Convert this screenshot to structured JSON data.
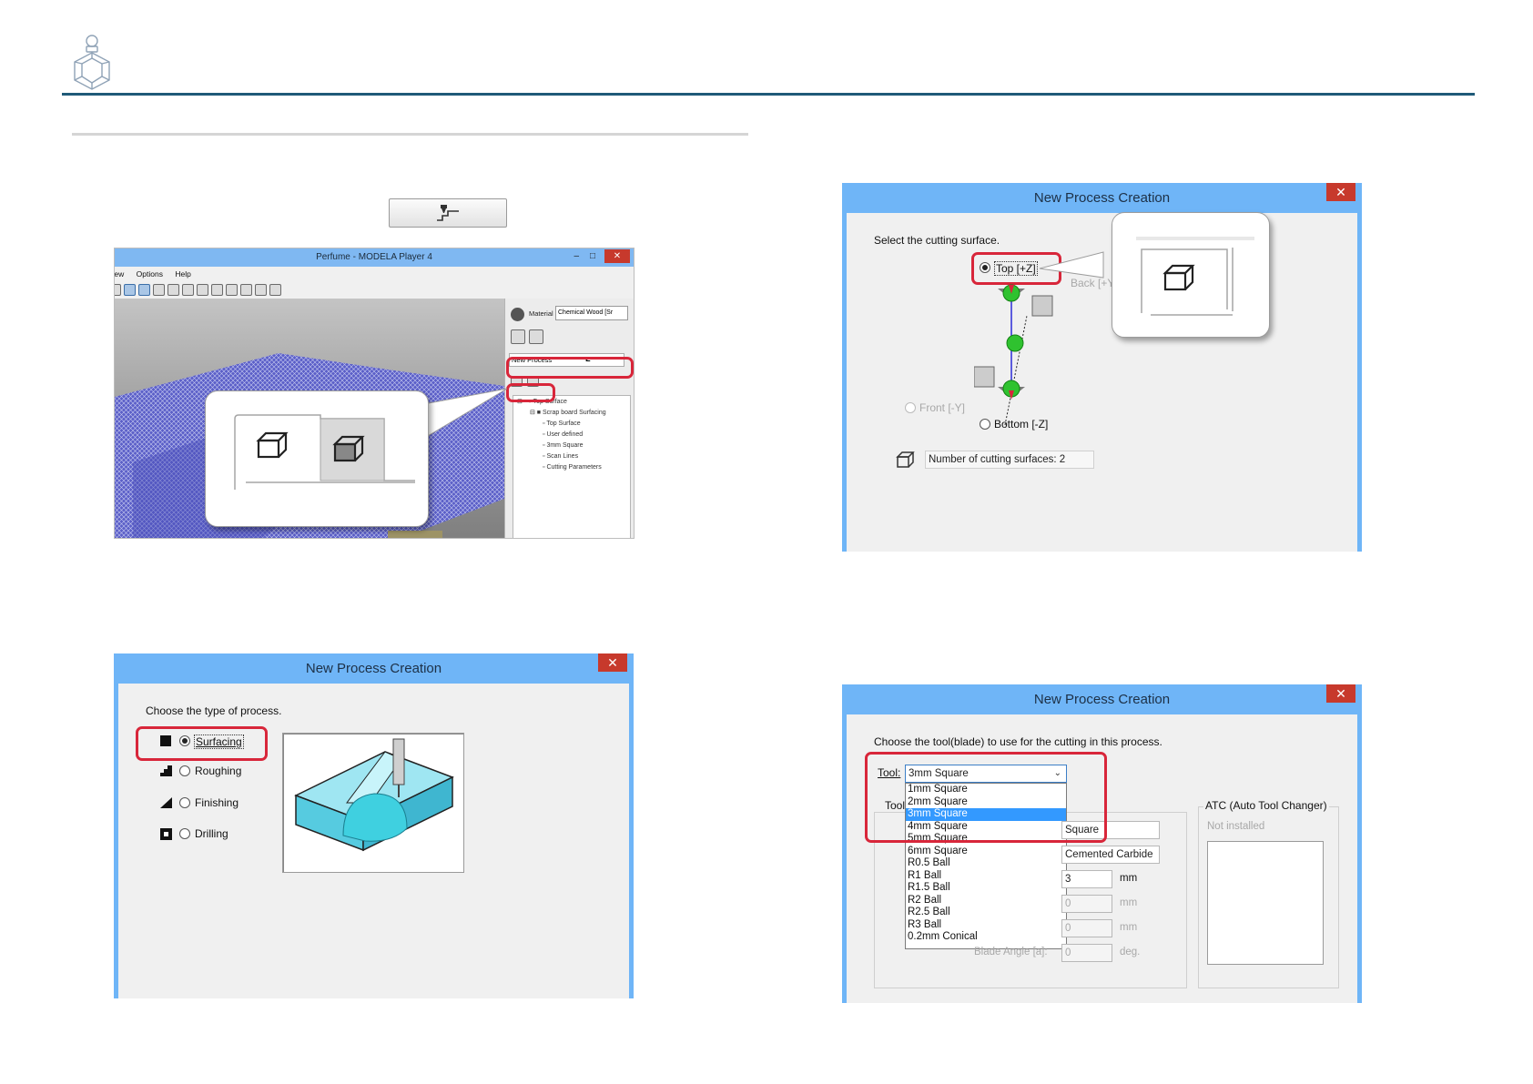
{
  "panel1": {
    "window_title": "Perfume - MODELA Player 4",
    "window_controls": [
      "–",
      "□",
      "✕"
    ],
    "menu": [
      "View",
      "Options",
      "Help"
    ],
    "material_label": "Material",
    "material_value": "Chemical Wood [Sr",
    "new_process_label": "New Process",
    "tree": [
      "Top Surface",
      "Scrap board Surfacing",
      "Top Surface",
      "User defined",
      "3mm Square",
      "Scan Lines",
      "Cutting Parameters"
    ]
  },
  "panel2": {
    "title": "New Process Creation",
    "close": "✕",
    "prompt": "Choose the type of process.",
    "options": [
      "Surfacing",
      "Roughing",
      "Finishing",
      "Drilling"
    ],
    "selected": "Surfacing"
  },
  "panel3": {
    "title": "New Process Creation",
    "close": "✕",
    "prompt": "Select the cutting surface.",
    "top": "Top [+Z]",
    "back": "Back [+Y]",
    "front": "Front [-Y]",
    "bottom": "Bottom [-Z]",
    "count": "Number of cutting surfaces: 2"
  },
  "panel4": {
    "title": "New Process Creation",
    "close": "✕",
    "prompt": "Choose the tool(blade) to use for the cutting in this process.",
    "tool_label": "Tool:",
    "tool_value": "3mm Square",
    "tool_group": "Tool",
    "tool_options": [
      "1mm Square",
      "2mm Square",
      "3mm Square",
      "4mm Square",
      "5mm Square",
      "6mm Square",
      "R0.5 Ball",
      "R1 Ball",
      "R1.5 Ball",
      "R2 Ball",
      "R2.5 Ball",
      "R3 Ball",
      "0.2mm Conical"
    ],
    "selected_index": 2,
    "shape": "Square",
    "material": "Cemented Carbide",
    "diameter": "3",
    "unit_mm": "mm",
    "field2": "0",
    "field3": "0",
    "blade_angle_label": "Blade Angle [a]:",
    "blade_angle": "0",
    "unit_deg": "deg.",
    "atc_title": "ATC (Auto Tool Changer)",
    "atc_status": "Not installed"
  }
}
